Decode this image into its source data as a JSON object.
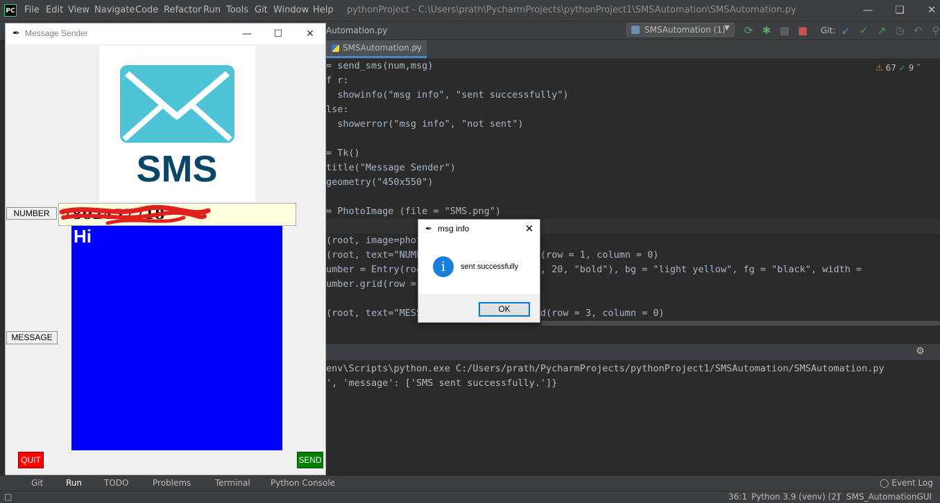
{
  "ide": {
    "logo": "PC",
    "menu": [
      "File",
      "Edit",
      "View",
      "Navigate",
      "Code",
      "Refactor",
      "Run",
      "Tools",
      "Git",
      "Window",
      "Help"
    ],
    "title": "pythonProject - C:\\Users\\prath\\PycharmProjects\\pythonProject1\\SMSAutomation\\SMSAutomation.py",
    "breadcrumb": "Automation.py",
    "run_config": "SMSAutomation (1)",
    "git_label": "Git:",
    "tab_label": "SMSAutomation.py",
    "inspections": {
      "warnings": "67",
      "weak": "9"
    },
    "code_lines": [
      "= send_sms(num,msg)",
      "f r:",
      "  showinfo(\"msg info\", \"sent successfully\")",
      "lse:",
      "  showerror(\"msg info\", \"not sent\")",
      "",
      "= Tk()",
      "title(\"Message Sender\")",
      "geometry(\"450x550\")",
      "",
      "= PhotoImage (file = \"SMS.png\")",
      "",
      "(root, image=photo, width=1)",
      "(root, text=\"NUMBER\", width = 10).grid(row = 1, column = 0)",
      "umber = Entry(root, font = (\"Algerian\", 20, \"bold\"), bg = \"light yellow\", fg = \"black\", width =",
      "umber.grid(row = 1",
      "",
      "(root, text=\"MESSAGE\", width = 10).grid(row = 3, column = 0)"
    ],
    "console_lines": [
      "env\\Scripts\\python.exe C:/Users/prath/PycharmProjects/pythonProject1/SMSAutomation/SMSAutomation.py",
      "', 'message': ['SMS sent successfully.']}"
    ],
    "bottom_tools": [
      "Git",
      "Run",
      "TODO",
      "Problems",
      "Terminal",
      "Python Console"
    ],
    "event_log": "Event Log",
    "status": {
      "position": "36:1",
      "interpreter": "Python 3.9 (venv) (2)",
      "branch": "SMS_AutomationGUI"
    }
  },
  "tk": {
    "title": "Message Sender",
    "logo_text": "SMS",
    "number_label": "NUMBER",
    "number_value": "7802457718",
    "message_label": "MESSAGE",
    "message_value": "Hi",
    "quit_label": "QUIT",
    "send_label": "SEND",
    "colors": {
      "envelope": "#4ec4d6",
      "sms_text": "#0b4669",
      "message_bg": "#0000ff",
      "entry_bg": "#ffffe0",
      "quit": "#ff0000",
      "send": "#008000"
    }
  },
  "dialog": {
    "title": "msg info",
    "message": "sent successfully",
    "ok_label": "OK",
    "icon": "info-icon"
  }
}
